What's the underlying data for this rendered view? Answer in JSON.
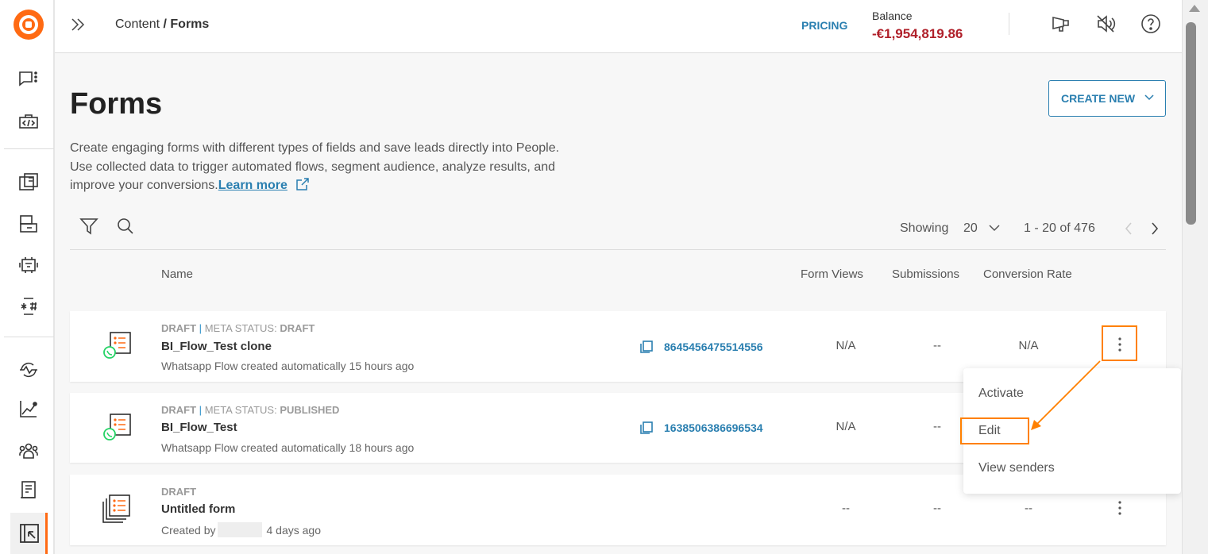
{
  "header": {
    "breadcrumb_parent": "Content",
    "breadcrumb_sep": " / ",
    "breadcrumb_current": "Forms",
    "pricing": "PRICING",
    "balance_label": "Balance",
    "balance_value": "-€1,954,819.86"
  },
  "page": {
    "title": "Forms",
    "create_new": "CREATE NEW",
    "description_1": "Create engaging forms with different types of fields and save leads directly into People.",
    "description_2": "Use collected data to trigger automated flows, segment audience, analyze results, and",
    "description_3": "improve your conversions.",
    "learn_more": "Learn more"
  },
  "toolbar": {
    "showing_label": "Showing",
    "page_size": "20",
    "range": "1 - 20 of 476"
  },
  "table": {
    "columns": [
      "Name",
      "Form Views",
      "Submissions",
      "Conversion Rate"
    ],
    "rows": [
      {
        "status": "DRAFT",
        "meta_label": "META STATUS: ",
        "meta_value": "DRAFT",
        "name": "BI_Flow_Test clone",
        "subtitle": "Whatsapp Flow created automatically 15 hours ago",
        "id": "8645456475514556",
        "views": "N/A",
        "submissions": "--",
        "conversion": "N/A"
      },
      {
        "status": "DRAFT",
        "meta_label": "META STATUS: ",
        "meta_value": "PUBLISHED",
        "name": "BI_Flow_Test",
        "subtitle": "Whatsapp Flow created automatically 18 hours ago",
        "id": "1638506386696534",
        "views": "N/A",
        "submissions": "--",
        "conversion": ""
      },
      {
        "status": "DRAFT",
        "name": "Untitled form",
        "subtitle_prefix": "Created by",
        "subtitle_suffix": "4 days ago",
        "views": "--",
        "submissions": "--",
        "conversion": "--"
      }
    ]
  },
  "menu": {
    "items": [
      "Activate",
      "Edit",
      "View senders"
    ]
  },
  "colors": {
    "accent": "#2a7fb0",
    "brand": "#ff6a13",
    "balance": "#b0202a",
    "highlight": "#ff8000",
    "whatsapp": "#25d366"
  }
}
